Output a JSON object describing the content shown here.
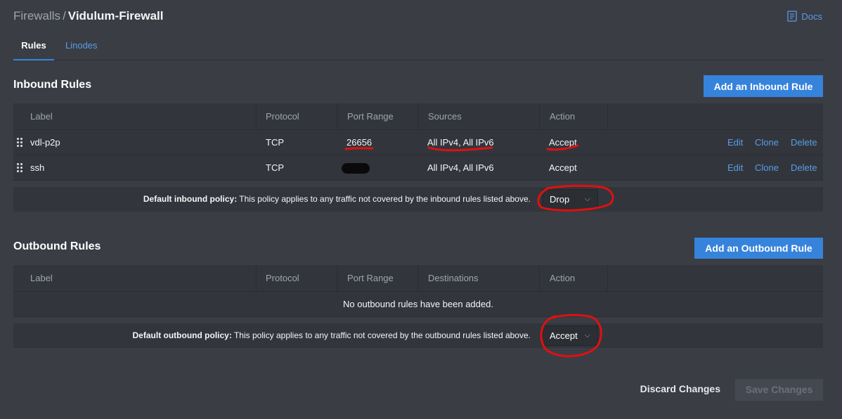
{
  "breadcrumb": {
    "parent": "Firewalls",
    "separator": "/",
    "current": "Vidulum-Firewall"
  },
  "docs": {
    "label": "Docs",
    "icon": "docs-icon"
  },
  "tabs": [
    {
      "label": "Rules",
      "active": true
    },
    {
      "label": "Linodes",
      "active": false
    }
  ],
  "inbound": {
    "title": "Inbound Rules",
    "add_button": "Add an Inbound Rule",
    "columns": [
      "Label",
      "Protocol",
      "Port Range",
      "Sources",
      "Action"
    ],
    "rows": [
      {
        "label": "vdl-p2p",
        "protocol": "TCP",
        "port": "26656",
        "sources": "All IPv4, All IPv6",
        "action": "Accept"
      },
      {
        "label": "ssh",
        "protocol": "TCP",
        "port": "",
        "sources": "All IPv4, All IPv6",
        "action": "Accept"
      }
    ],
    "row_actions": [
      "Edit",
      "Clone",
      "Delete"
    ],
    "policy": {
      "bold": "Default inbound policy:",
      "text": " This policy applies to any traffic not covered by the inbound rules listed above.",
      "value": "Drop"
    }
  },
  "outbound": {
    "title": "Outbound Rules",
    "add_button": "Add an Outbound Rule",
    "columns": [
      "Label",
      "Protocol",
      "Port Range",
      "Destinations",
      "Action"
    ],
    "empty_message": "No outbound rules have been added.",
    "policy": {
      "bold": "Default outbound policy:",
      "text": " This policy applies to any traffic not covered by the outbound rules listed above.",
      "value": "Accept"
    }
  },
  "footer": {
    "discard": "Discard Changes",
    "save": "Save Changes"
  },
  "colors": {
    "background": "#3a3d44",
    "table": "#32363c",
    "accent": "#3683dc",
    "link": "#5a9ce8",
    "annotation": "#e01010"
  }
}
